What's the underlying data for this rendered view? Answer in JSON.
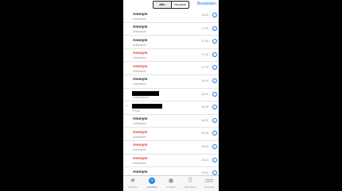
{
  "header": {
    "segments": [
      "Alle",
      "Verpasst"
    ],
    "active_segment": "Alle",
    "edit_label": "Bearbeiten"
  },
  "calls": [
    {
      "name": "Anonym",
      "sub": "Unbekannt",
      "time": "19:03",
      "missed": false
    },
    {
      "name": "Anonym",
      "sub": "Unbekannt",
      "time": "17:53",
      "missed": false
    },
    {
      "name": "Anonym",
      "sub": "Unbekannt",
      "time": "17:53",
      "missed": false
    },
    {
      "name": "Anonym",
      "sub": "Unbekannt",
      "time": "17:19",
      "missed": true
    },
    {
      "name": "Anonym",
      "sub": "Unbekannt",
      "time": "17:19",
      "missed": true
    },
    {
      "name": "Anonym",
      "sub": "Unbekannt",
      "time": "16:44",
      "missed": false
    },
    {
      "name": "",
      "sub": "Lebenshemd",
      "time": "16:29",
      "missed": false,
      "redacted": true
    },
    {
      "name": "",
      "sub": "Privat",
      "time": "16:29",
      "missed": false,
      "redacted": true,
      "outgoing": true
    },
    {
      "name": "Anonym",
      "sub": "Unbekannt",
      "time": "16:20",
      "missed": false
    },
    {
      "name": "Anonym",
      "sub": "Unbekannt",
      "time": "16:19",
      "missed": true
    },
    {
      "name": "Anonym",
      "sub": "Unbekannt",
      "time": "15:02",
      "missed": true
    },
    {
      "name": "Anonym",
      "sub": "Unbekannt",
      "time": "15:41",
      "missed": true
    },
    {
      "name": "Anonym",
      "sub": "Unbekannt",
      "time": "14:51",
      "missed": false
    }
  ],
  "tabbar": [
    {
      "label": "Favoriten",
      "icon": "star-icon",
      "glyph": "★"
    },
    {
      "label": "Anrufliste",
      "icon": "clock-icon",
      "glyph": "",
      "active": true
    },
    {
      "label": "Kontakte",
      "icon": "contacts-icon",
      "glyph": "◉"
    },
    {
      "label": "Ziffernblock",
      "icon": "keypad-icon",
      "glyph": "⠿"
    },
    {
      "label": "Voicemail",
      "icon": "voicemail-icon",
      "glyph": "ᴑᴑ"
    }
  ],
  "colors": {
    "accent": "#1a7cf0",
    "missed": "#d9342b"
  }
}
